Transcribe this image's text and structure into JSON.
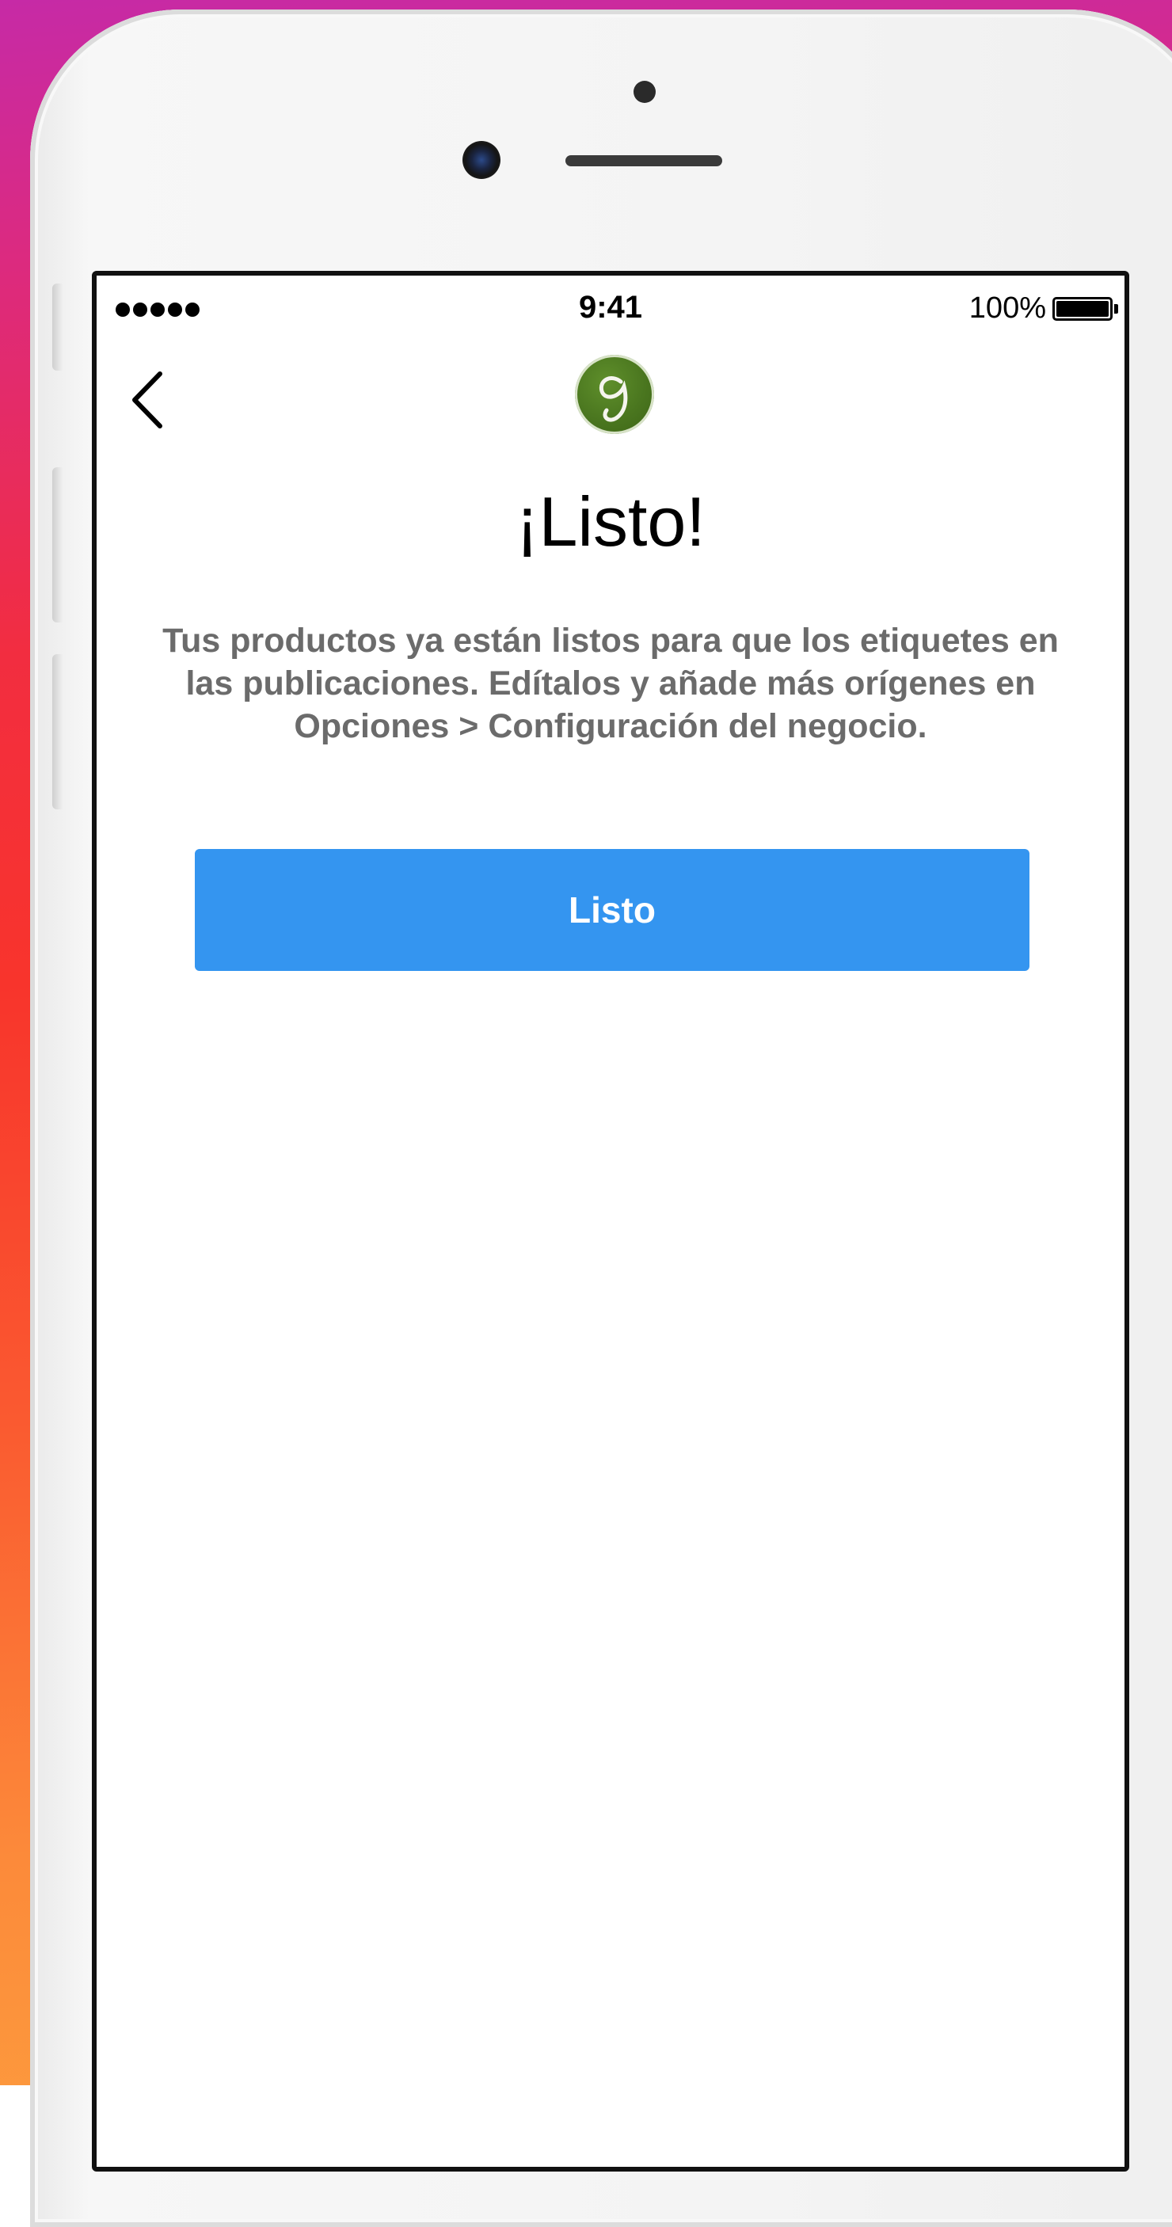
{
  "status_bar": {
    "time": "9:41",
    "battery_percent": "100%",
    "signal_bars": 5
  },
  "nav": {
    "back_icon": "chevron-left-icon",
    "logo_icon": "business-logo-icon"
  },
  "content": {
    "title": "¡Listo!",
    "description": "Tus productos ya están listos para que los etiquetes en las publicaciones. Edítalos y añade más orígenes en Opciones > Configuración del negocio.",
    "button_label": "Listo"
  },
  "colors": {
    "button": "#3495f0",
    "logo": "#4a761f",
    "description_text": "#6b6b6b"
  }
}
